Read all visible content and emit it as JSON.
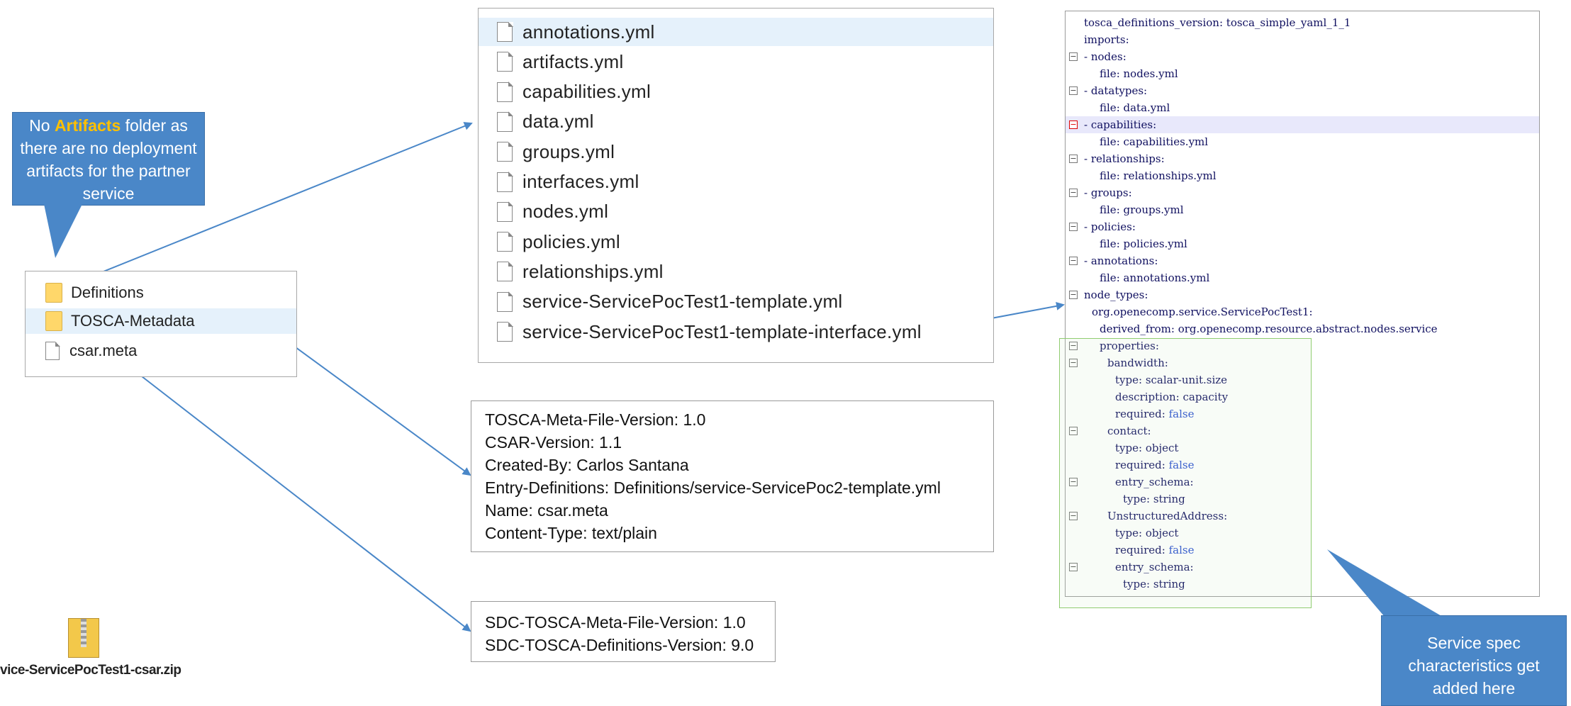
{
  "callout_left": {
    "prefix": "No ",
    "highlight": "Artifacts",
    "rest": " folder as there are no deployment artifacts for the partner service"
  },
  "callout_right": {
    "text": "Service spec characteristics get added here"
  },
  "root_folder": {
    "items": [
      {
        "label": "Definitions",
        "type": "folder"
      },
      {
        "label": "TOSCA-Metadata",
        "type": "folder"
      },
      {
        "label": "csar.meta",
        "type": "file"
      }
    ]
  },
  "zip_file": {
    "label": "vice-ServicePocTest1-csar.zip"
  },
  "definitions_folder": {
    "items": [
      "annotations.yml",
      "artifacts.yml",
      "capabilities.yml",
      "data.yml",
      "groups.yml",
      "interfaces.yml",
      "nodes.yml",
      "policies.yml",
      "relationships.yml",
      "service-ServicePocTest1-template.yml",
      "service-ServicePocTest1-template-interface.yml"
    ]
  },
  "tosca_meta": {
    "lines": [
      "TOSCA-Meta-File-Version: 1.0",
      "CSAR-Version: 1.1",
      "Created-By: Carlos Santana",
      "Entry-Definitions: Definitions/service-ServicePoc2-template.yml",
      "Name: csar.meta",
      "Content-Type: text/plain"
    ]
  },
  "csar_meta": {
    "lines": [
      "SDC-TOSCA-Meta-File-Version: 1.0",
      "SDC-TOSCA-Definitions-Version: 9.0"
    ]
  },
  "template_code": {
    "lines": [
      {
        "key": "tosca_definitions_version",
        "value": "tosca_simple_yaml_1_1"
      },
      {
        "key": "imports",
        "value": ""
      },
      {
        "key": "- nodes",
        "value": ""
      },
      {
        "key": "file",
        "value": "nodes.yml"
      },
      {
        "key": "- datatypes",
        "value": ""
      },
      {
        "key": "file",
        "value": "data.yml"
      },
      {
        "key": "- capabilities",
        "value": ""
      },
      {
        "key": "file",
        "value": "capabilities.yml"
      },
      {
        "key": "- relationships",
        "value": ""
      },
      {
        "key": "file",
        "value": "relationships.yml"
      },
      {
        "key": "- groups",
        "value": ""
      },
      {
        "key": "file",
        "value": "groups.yml"
      },
      {
        "key": "- policies",
        "value": ""
      },
      {
        "key": "file",
        "value": "policies.yml"
      },
      {
        "key": "- annotations",
        "value": ""
      },
      {
        "key": "file",
        "value": "annotations.yml"
      },
      {
        "key": "node_types",
        "value": ""
      },
      {
        "key": "org.openecomp.service.ServicePocTest1",
        "value": ""
      },
      {
        "key": "derived_from",
        "value": "org.openecomp.resource.abstract.nodes.service"
      },
      {
        "key": "properties",
        "value": ""
      },
      {
        "key": "bandwidth",
        "value": ""
      },
      {
        "key": "type",
        "value": "scalar-unit.size"
      },
      {
        "key": "description",
        "value": "capacity"
      },
      {
        "key": "required",
        "value": "false"
      },
      {
        "key": "contact",
        "value": ""
      },
      {
        "key": "type",
        "value": "object"
      },
      {
        "key": "required",
        "value": "false"
      },
      {
        "key": "entry_schema",
        "value": ""
      },
      {
        "key": "type",
        "value": "string"
      },
      {
        "key": "UnstructuredAddress",
        "value": ""
      },
      {
        "key": "type",
        "value": "object"
      },
      {
        "key": "required",
        "value": "false"
      },
      {
        "key": "entry_schema",
        "value": ""
      },
      {
        "key": "type",
        "value": "string"
      }
    ]
  },
  "colors": {
    "callout": "#4a87c8",
    "highlight": "#ffc000",
    "arrow": "#4a87c8",
    "selection": "#e5f1fb",
    "green_box": "#90cc70"
  }
}
